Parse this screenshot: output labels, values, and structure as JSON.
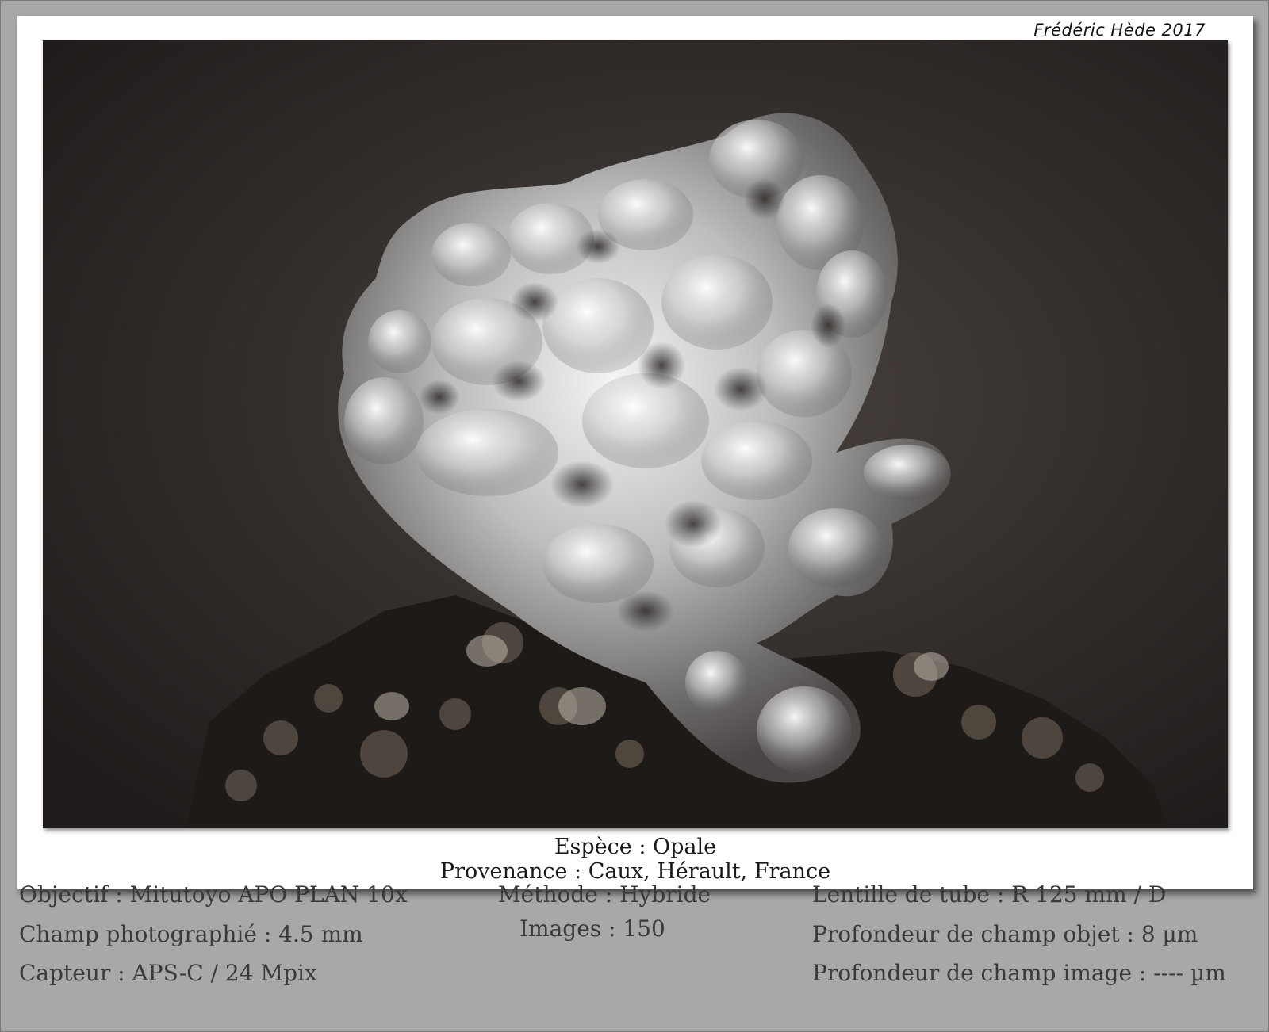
{
  "credit": "Frédéric Hède 2017",
  "caption": {
    "species": "Espèce : Opale",
    "origin": "Provenance : Caux, Hérault, France"
  },
  "specs": {
    "col1": [
      "Objectif : Mitutoyo APO PLAN 10x",
      "Champ photographié : 4.5 mm",
      "Capteur : APS-C / 24 Mpix"
    ],
    "col2": [
      "Méthode : Hybride",
      "Images : 150"
    ],
    "col3": [
      "Lentille de tube : R 125 mm / D",
      "Profondeur de champ objet : 8 µm",
      "Profondeur de champ image : ---- µm"
    ]
  }
}
